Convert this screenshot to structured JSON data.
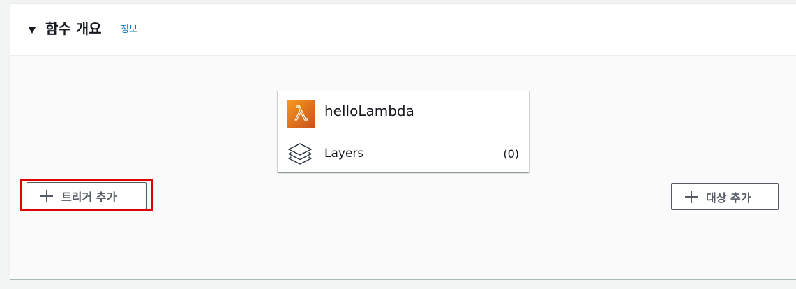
{
  "header": {
    "title": "함수 개요",
    "info_link": "정보"
  },
  "function_card": {
    "name": "helloLambda",
    "icon": "lambda-icon",
    "layers_label": "Layers",
    "layers_count": "(0)",
    "layers_icon": "layers-stack-icon"
  },
  "buttons": {
    "add_trigger": "트리거 추가",
    "add_destination": "대상 추가"
  },
  "colors": {
    "lambda_orange": "#e8701a",
    "link_blue": "#0073bb",
    "highlight_red": "#e00000"
  }
}
